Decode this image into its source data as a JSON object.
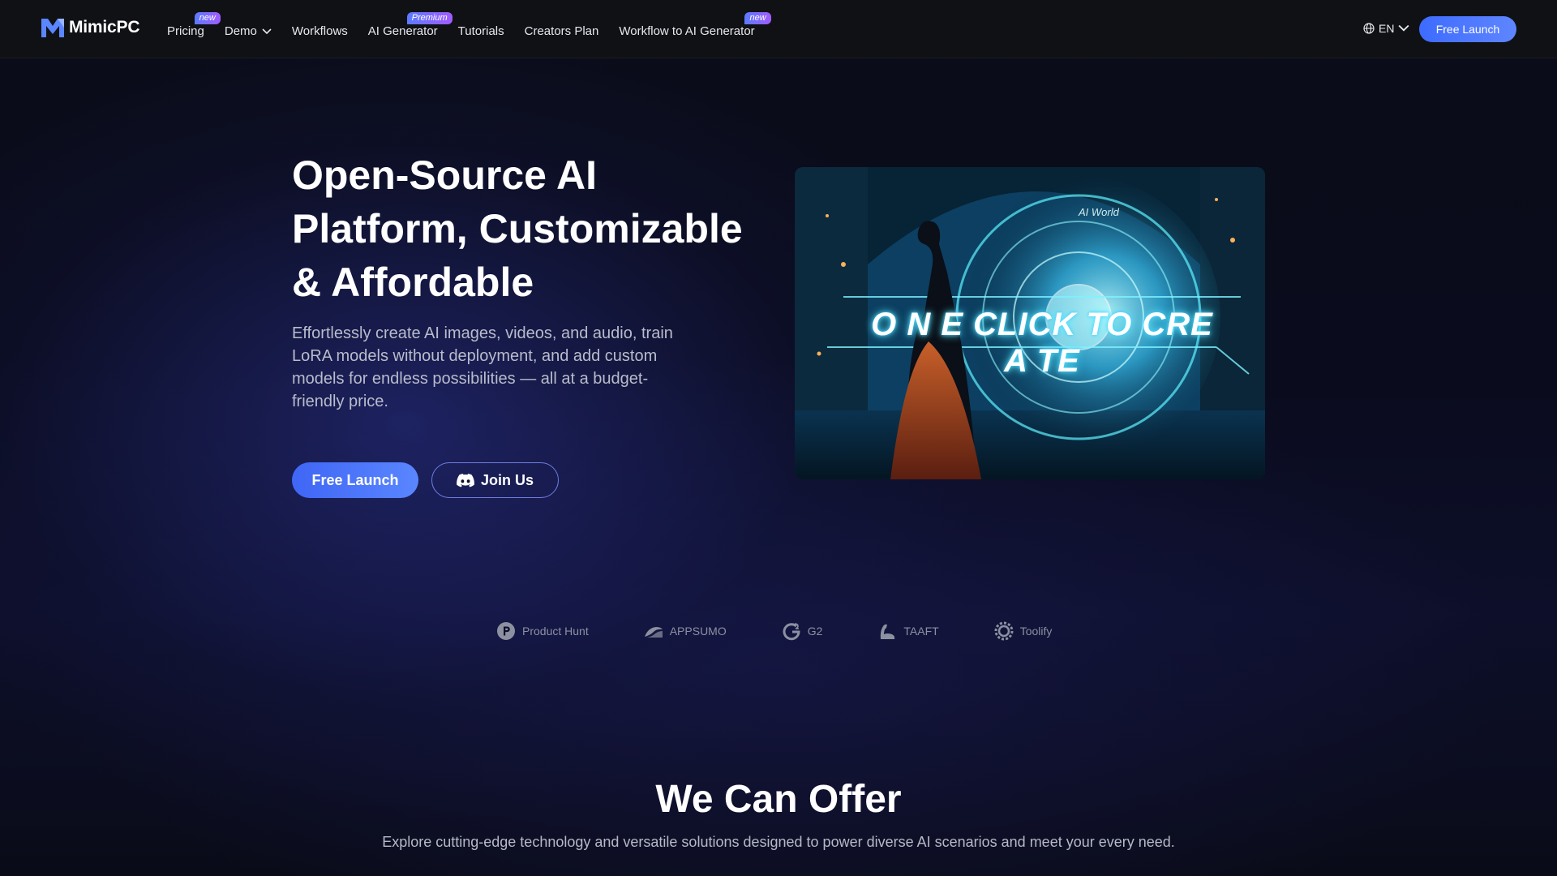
{
  "brand": {
    "name": "MimicPC"
  },
  "nav": {
    "items": [
      {
        "label": "Pricing",
        "badge": "new"
      },
      {
        "label": "Demo",
        "badge": ""
      },
      {
        "label": "Workflows",
        "badge": ""
      },
      {
        "label": "AI Generator",
        "badge": "Premium"
      },
      {
        "label": "Tutorials",
        "badge": ""
      },
      {
        "label": "Creators Plan",
        "badge": ""
      },
      {
        "label": "Workflow to AI Generator",
        "badge": "new"
      }
    ],
    "language": "EN",
    "cta_label": "Free Launch"
  },
  "hero": {
    "title": "Open-Source AI Platform, Customizable & Affordable",
    "subtitle": "Effortlessly create AI images, videos, and audio, train LoRA models without deployment, and add custom models for endless possibilities — all at a budget-friendly price.",
    "primary_button": "Free Launch",
    "secondary_button": "Join Us",
    "image_caption": "O N E CLICK TO CRE A  TE",
    "image_small_text": "AI World"
  },
  "partners": [
    {
      "name": "Product Hunt",
      "icon": "product-hunt-icon"
    },
    {
      "name": "APPSUMO",
      "icon": "appsumo-icon"
    },
    {
      "name": "G2",
      "icon": "g2-icon"
    },
    {
      "name": "TAAFT",
      "icon": "taaft-icon"
    },
    {
      "name": "Toolify",
      "icon": "toolify-icon"
    }
  ],
  "offer": {
    "title": "We Can Offer",
    "subtitle": "Explore cutting-edge technology and versatile solutions designed to power diverse AI scenarios and meet your every need."
  },
  "colors": {
    "accent": "#4a72ff",
    "badge_gradient_start": "#5b7bff",
    "badge_gradient_end": "#a25cff"
  }
}
